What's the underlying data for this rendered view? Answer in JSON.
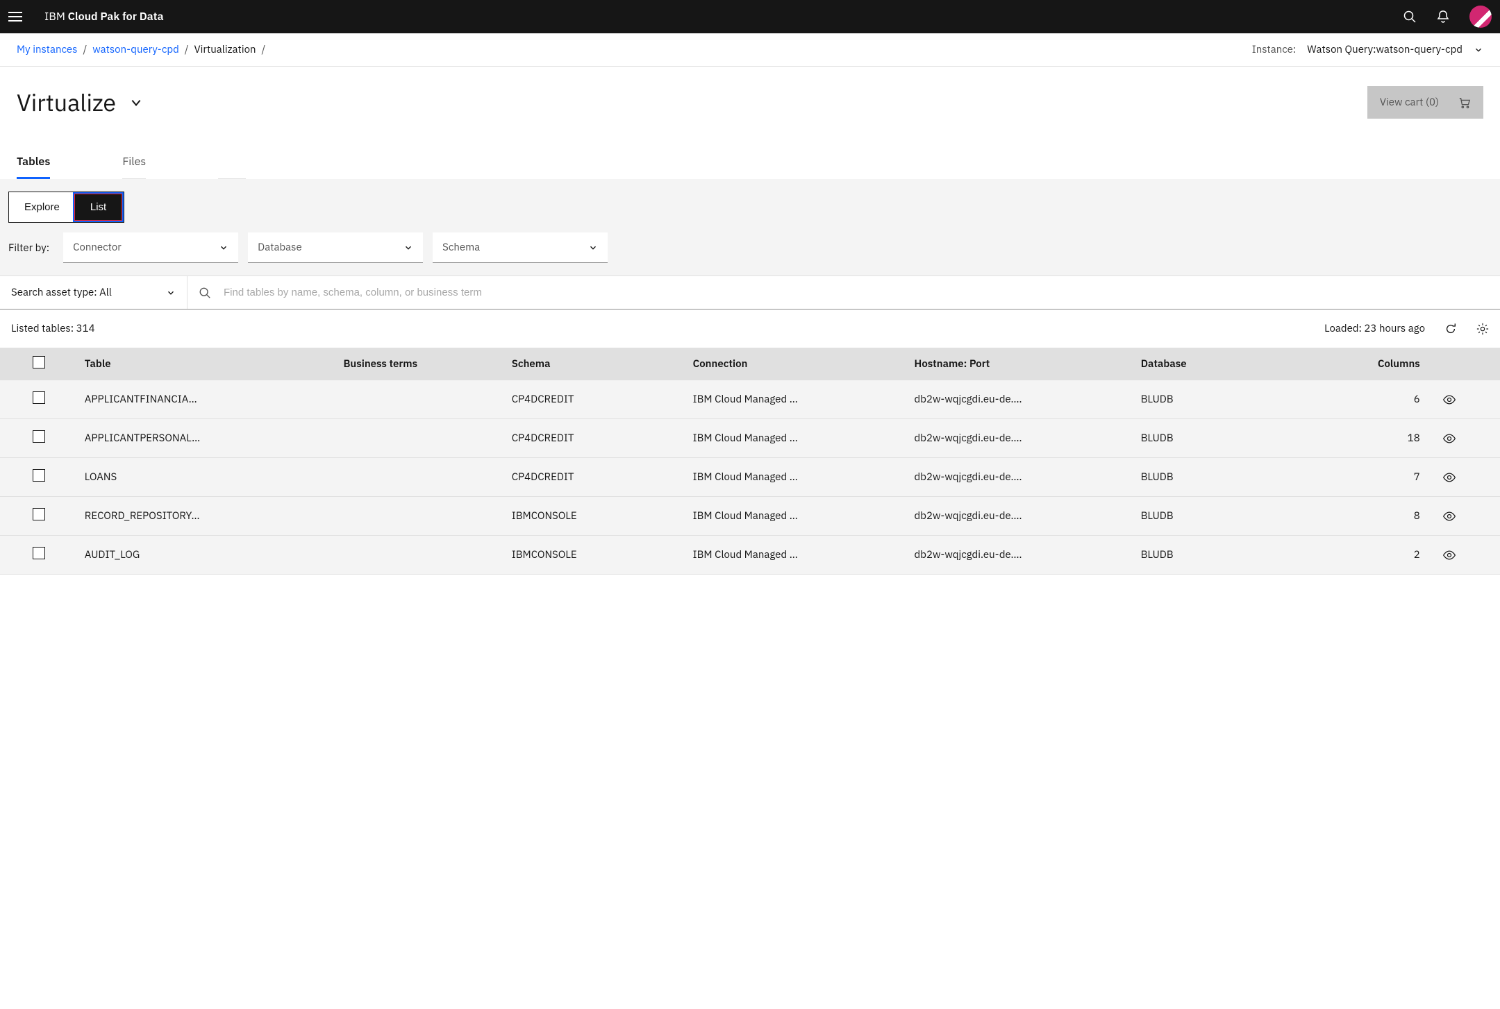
{
  "brand": {
    "prefix": "IBM",
    "product": "Cloud Pak for Data"
  },
  "breadcrumb": {
    "items": [
      "My instances",
      "watson-query-cpd",
      "Virtualization"
    ],
    "instance_label": "Instance:",
    "instance_value": "Watson Query:watson-query-cpd"
  },
  "page": {
    "title": "Virtualize",
    "cart_label": "View cart (0)"
  },
  "tabs": {
    "items": [
      "Tables",
      "Files"
    ],
    "active": 0
  },
  "segmented": {
    "explore": "Explore",
    "list": "List"
  },
  "filters": {
    "label": "Filter by:",
    "connector": "Connector",
    "database": "Database",
    "schema": "Schema"
  },
  "search": {
    "asset_type": "Search asset type: All",
    "placeholder": "Find tables by name, schema, column, or business term"
  },
  "status": {
    "listed": "Listed tables: 314",
    "loaded": "Loaded: 23 hours ago"
  },
  "table": {
    "headers": {
      "table": "Table",
      "business_terms": "Business terms",
      "schema": "Schema",
      "connection": "Connection",
      "hostname": "Hostname: Port",
      "database": "Database",
      "columns": "Columns"
    },
    "rows": [
      {
        "table": "APPLICANTFINANCIA…",
        "business_terms": "",
        "schema": "CP4DCREDIT",
        "connection": "IBM Cloud Managed …",
        "hostname": "db2w-wqjcgdi.eu-de.…",
        "database": "BLUDB",
        "columns": 6
      },
      {
        "table": "APPLICANTPERSONAL…",
        "business_terms": "",
        "schema": "CP4DCREDIT",
        "connection": "IBM Cloud Managed …",
        "hostname": "db2w-wqjcgdi.eu-de.…",
        "database": "BLUDB",
        "columns": 18
      },
      {
        "table": "LOANS",
        "business_terms": "",
        "schema": "CP4DCREDIT",
        "connection": "IBM Cloud Managed …",
        "hostname": "db2w-wqjcgdi.eu-de.…",
        "database": "BLUDB",
        "columns": 7
      },
      {
        "table": "RECORD_REPOSITORY…",
        "business_terms": "",
        "schema": "IBMCONSOLE",
        "connection": "IBM Cloud Managed …",
        "hostname": "db2w-wqjcgdi.eu-de.…",
        "database": "BLUDB",
        "columns": 8
      },
      {
        "table": "AUDIT_LOG",
        "business_terms": "",
        "schema": "IBMCONSOLE",
        "connection": "IBM Cloud Managed …",
        "hostname": "db2w-wqjcgdi.eu-de.…",
        "database": "BLUDB",
        "columns": 2
      }
    ]
  }
}
